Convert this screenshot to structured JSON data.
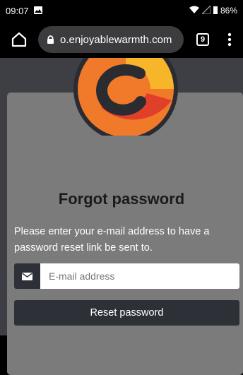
{
  "status_bar": {
    "time": "09:07",
    "battery": "86%",
    "icons": [
      "image-icon",
      "wifi-icon",
      "cell-signal-icon",
      "battery-icon"
    ]
  },
  "browser": {
    "url": "o.enjoyablewarmth.com",
    "tab_count": "9",
    "icons": [
      "home-icon",
      "lock-icon",
      "tabs-icon",
      "menu-icon"
    ]
  },
  "page": {
    "heading": "Forgot password",
    "instructions": "Please enter your e-mail address to have a password reset link be sent to.",
    "email_placeholder": "E-mail address",
    "email_value": "",
    "reset_button_label": "Reset password"
  },
  "colors": {
    "background": "#3d3f44",
    "card": "#7b7b7b",
    "button": "#2d3137",
    "logo_orange": "#f07a2a",
    "logo_yellow": "#f7b52a",
    "logo_red": "#e0402a"
  }
}
